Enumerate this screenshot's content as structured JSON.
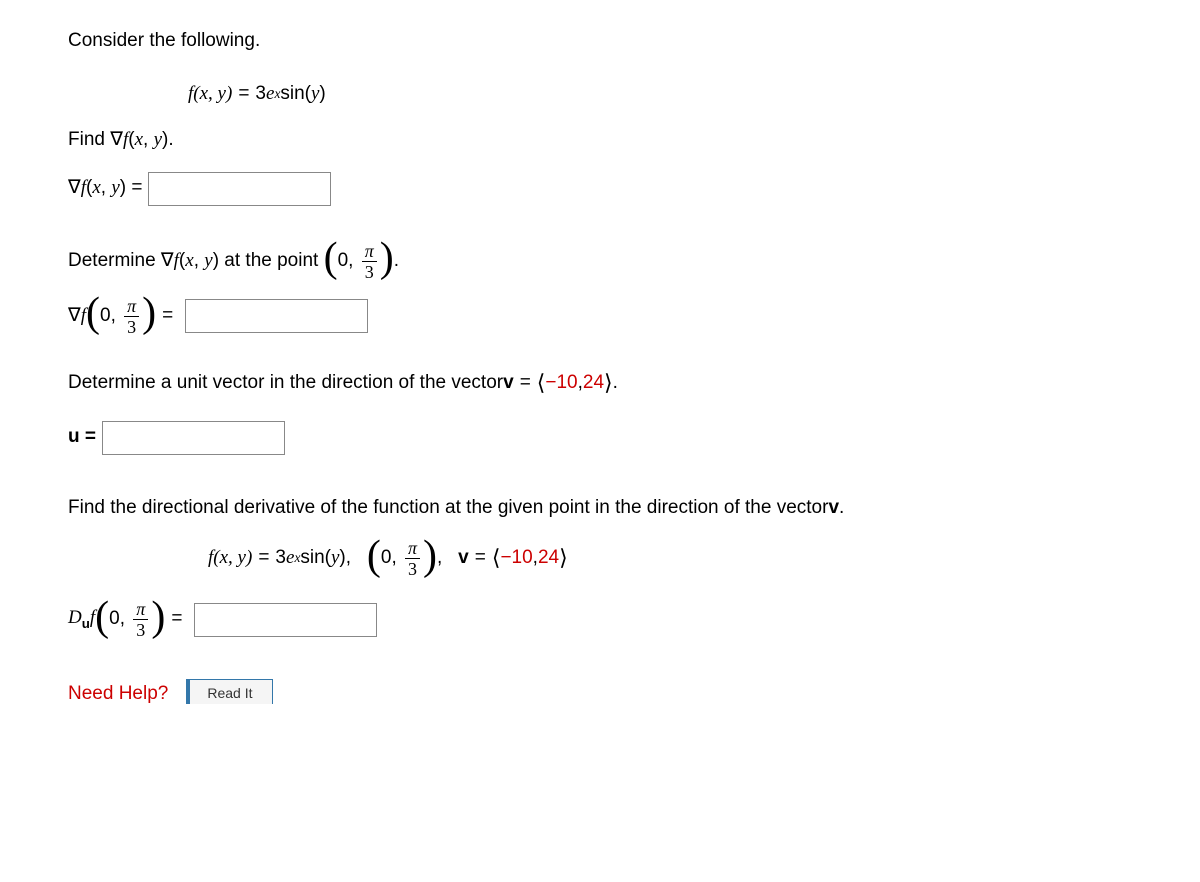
{
  "line1": "Consider the following.",
  "func_def": {
    "lhs": "f(x, y)",
    "rhs_num": "3",
    "rhs_base": "e",
    "rhs_exp": "x",
    "rest": " sin(",
    "arg": "y",
    "close": ")"
  },
  "find_grad": "Find ∇f(x, y).",
  "grad_label": "∇f(x, y) =",
  "determine_grad_at": "Determine ∇f(x, y) at the point ",
  "point": {
    "first": "0",
    "frac_num": "π",
    "frac_den": "3"
  },
  "grad_at_label_pre": "∇f",
  "equals": "=",
  "unit_vector_text": "Determine a unit vector in the direction of the vector ",
  "vector_v": {
    "sym": "v",
    "open": "⟨",
    "a": "−10",
    "b": "24",
    "close": "⟩",
    "comma": ", "
  },
  "u_label": "u =",
  "dir_deriv_text": "Find the directional derivative of the function at the given point in the direction of the vector ",
  "v_bold": "v",
  "period": ".",
  "summary": {
    "f_lhs": "f(x, y)",
    "f_num": "3",
    "f_base": "e",
    "f_exp": "x",
    "f_sin_open": " sin(",
    "f_sin_arg": "y",
    "f_sin_close": ")",
    "pt_first": "0",
    "pt_num": "π",
    "pt_den": "3",
    "v_sym": "v",
    "v_a": "−10",
    "v_b": "24"
  },
  "du_label_D": "D",
  "du_label_sub": "u",
  "du_label_f": "f",
  "need_help": "Need Help?",
  "read_it": "Read It"
}
